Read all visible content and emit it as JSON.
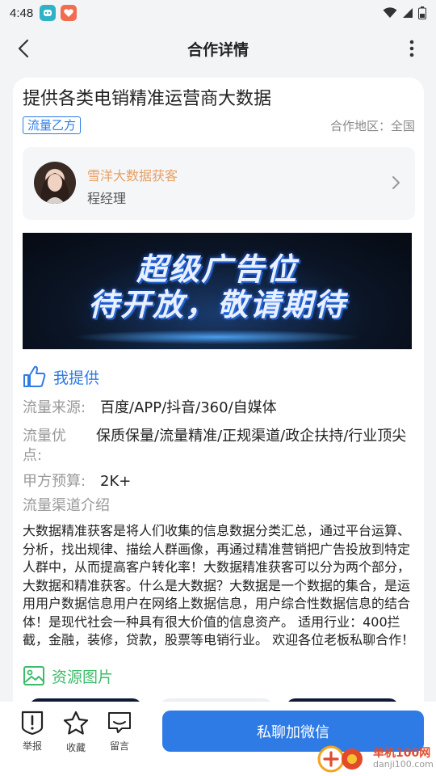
{
  "status_bar": {
    "time": "4:48"
  },
  "header": {
    "title": "合作详情"
  },
  "post": {
    "title": "提供各类电销精准运营商大数据",
    "tag": "流量乙方",
    "region_label": "合作地区：",
    "region_value": "全国"
  },
  "contact": {
    "company": "雪洋大数据获客",
    "person": "程经理"
  },
  "banner": {
    "line1": "超级广告位",
    "line2": "待开放，敬请期待"
  },
  "offer": {
    "section_title": "我提供",
    "fields": [
      {
        "label": "流量来源:",
        "value": "百度/APP/抖音/360/自媒体"
      },
      {
        "label": "流量优点:",
        "value": "保质保量/流量精准/正规渠道/政企扶持/行业顶尖"
      },
      {
        "label": "甲方预算:",
        "value": "2K+"
      },
      {
        "label": "流量渠道介绍",
        "value": ""
      }
    ],
    "description": "大数据精准获客是将人们收集的信息数据分类汇总，通过平台运算、分析，找出规律、描绘人群画像，再通过精准营销把广告投放到特定人群中，从而提高客户转化率！大数据精准获客可以分为两个部分，大数据和精准获客。什么是大数据？大数据是一个数据的集合，是运用用户数据信息用户在网络上数据信息，用户综合性数据信息的结合体！是现代社会一种具有很大价值的信息资产。 适用行业：400拦截，金融，装修，贷款，股票等电销行业。 欢迎各位老板私聊合作！"
  },
  "resources": {
    "section_title": "资源图片"
  },
  "bottom_bar": {
    "report_label": "举报",
    "favorite_label": "收藏",
    "message_label": "留言",
    "chat_button": "私聊加微信"
  },
  "watermark": {
    "name": "单机100网",
    "url": "danji100.com"
  },
  "colors": {
    "accent": "#2f7be5",
    "green": "#3dbb6b",
    "orange": "#e8a062"
  }
}
